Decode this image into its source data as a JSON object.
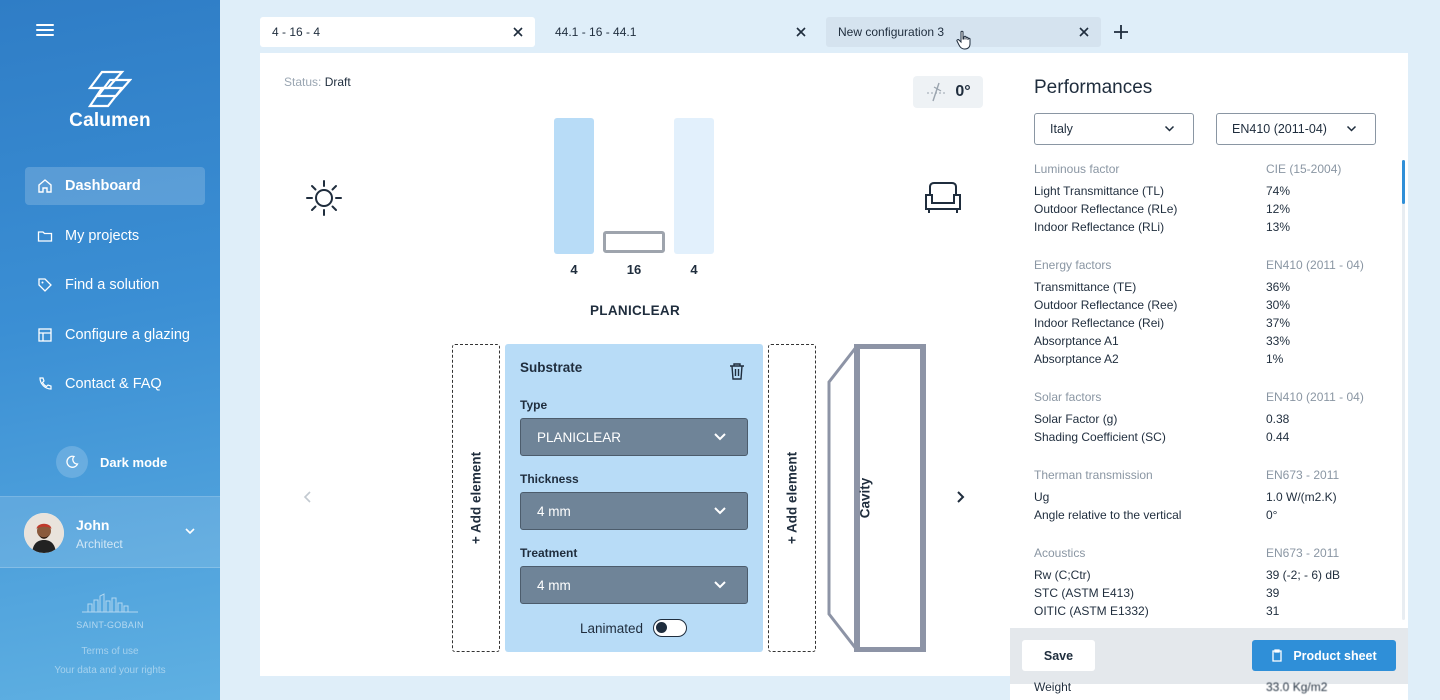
{
  "sidebar": {
    "brand": "Calumen",
    "nav": [
      {
        "label": "Dashboard",
        "icon": "home-icon",
        "active": true
      },
      {
        "label": "My projects",
        "icon": "folder-icon"
      },
      {
        "label": "Find a solution",
        "icon": "tag-icon"
      },
      {
        "label": "Configure a glazing",
        "icon": "layout-icon"
      },
      {
        "label": "Contact & FAQ",
        "icon": "phone-icon"
      }
    ],
    "dark_mode": "Dark mode",
    "user": {
      "name": "John",
      "role": "Architect"
    },
    "company": "SAINT-GOBAIN",
    "terms": "Terms of use",
    "rights": "Your data and your rights"
  },
  "tabs": [
    {
      "label": "4 - 16 - 4"
    },
    {
      "label": "44.1 - 16 - 44.1"
    },
    {
      "label": "New configuration 3"
    }
  ],
  "config": {
    "status_label": "Status:",
    "status_value": "Draft",
    "angle": "0°",
    "layers": [
      "4",
      "16",
      "4"
    ],
    "product": "PLANICLEAR",
    "add_element": "+ Add element",
    "substrate": {
      "title": "Substrate",
      "type_label": "Type",
      "type_value": "PLANICLEAR",
      "thickness_label": "Thickness",
      "thickness_value": "4 mm",
      "treatment_label": "Treatment",
      "treatment_value": "4 mm",
      "laminated_label": "Lanimated",
      "laminated": false
    },
    "cavity": "Cavity"
  },
  "performances": {
    "title": "Performances",
    "country": "Italy",
    "standard": "EN410 (2011-04)",
    "sections": [
      {
        "title": "Luminous factor",
        "standard": "CIE (15-2004)",
        "rows": [
          {
            "label": "Light Transmittance (TL)",
            "value": "74%"
          },
          {
            "label": "Outdoor Reflectance (RLe)",
            "value": "12%"
          },
          {
            "label": "Indoor Reflectance (RLi)",
            "value": "13%"
          }
        ]
      },
      {
        "title": "Energy factors",
        "standard": "EN410 (2011 - 04)",
        "rows": [
          {
            "label": "Transmittance (TE)",
            "value": "36%"
          },
          {
            "label": "Outdoor Reflectance (Ree)",
            "value": "30%"
          },
          {
            "label": "Indoor Reflectance (Rei)",
            "value": "37%"
          },
          {
            "label": "Absorptance A1",
            "value": "33%"
          },
          {
            "label": "Absorptance A2",
            "value": "1%"
          }
        ]
      },
      {
        "title": "Solar factors",
        "standard": "EN410 (2011 - 04)",
        "rows": [
          {
            "label": "Solar Factor (g)",
            "value": "0.38"
          },
          {
            "label": "Shading Coefficient (SC)",
            "value": "0.44"
          }
        ]
      },
      {
        "title": "Therman transmission",
        "standard": "EN673 - 2011",
        "rows": [
          {
            "label": "Ug",
            "value": "1.0 W/(m2.K)"
          },
          {
            "label": "Angle relative to the vertical",
            "value": "0°"
          }
        ]
      },
      {
        "title": "Acoustics",
        "standard": "EN673 - 2011",
        "rows": [
          {
            "label": "Rw (C;Ctr)",
            "value": "39 (-2; - 6) dB"
          },
          {
            "label": "STC (ASTM E413)",
            "value": "39"
          },
          {
            "label": "OITIC (ASTM E1332)",
            "value": "31"
          }
        ]
      }
    ],
    "save": "Save",
    "product_sheet": "Product sheet",
    "weight_label": "Weight",
    "weight_value": "33.0 Kg/m2"
  }
}
